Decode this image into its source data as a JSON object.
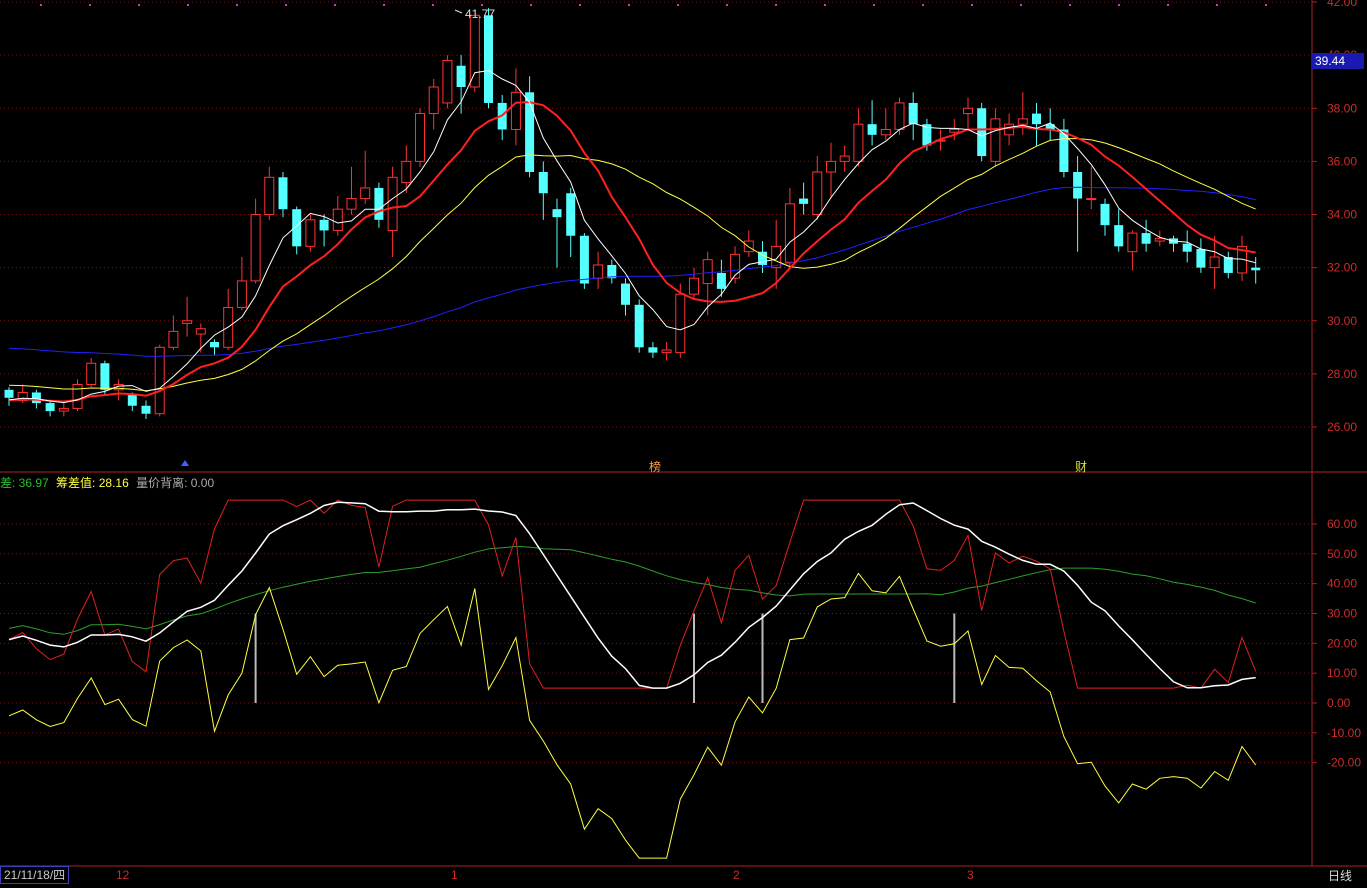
{
  "main_axis": {
    "ticks": [
      "42.00",
      "40.00",
      "38.00",
      "36.00",
      "34.00",
      "32.00",
      "30.00",
      "28.00",
      "26.00"
    ],
    "tick_values": [
      42,
      40,
      38,
      36,
      34,
      32,
      30,
      28,
      26
    ],
    "last_price_tag": "39.44",
    "high_label": "41.77"
  },
  "sub_axis": {
    "ticks": [
      "60.00",
      "50.00",
      "40.00",
      "30.00",
      "20.00",
      "10.00",
      "0.00",
      "-10.00",
      "-20.00"
    ],
    "tick_values": [
      60,
      50,
      40,
      30,
      20,
      10,
      0,
      -10,
      -20
    ]
  },
  "legend": {
    "item1": "差: 36.97",
    "item2_label": "筹差值: 28.16",
    "item3_label": "量价背离: 0.00"
  },
  "markers": {
    "m1": "榜",
    "m2": "财"
  },
  "bottom": {
    "date": "21/11/18/四",
    "months": [
      "12",
      "1",
      "2",
      "3"
    ],
    "period": "日线"
  },
  "colors": {
    "up": "#ff3232",
    "down": "#54ffff",
    "ma5": "#ffffff",
    "ma10": "#ff2020",
    "ma20": "#ffff40",
    "ma60": "#2020ff",
    "grid": "#7a1010"
  },
  "chart_data": {
    "type": "candlestick",
    "candles": [
      [
        27.4,
        27.1,
        26.8,
        27.5
      ],
      [
        27.0,
        27.3,
        26.9,
        27.6
      ],
      [
        27.3,
        26.9,
        26.7,
        27.4
      ],
      [
        26.9,
        26.6,
        26.4,
        27.0
      ],
      [
        26.6,
        26.7,
        26.4,
        27.0
      ],
      [
        26.7,
        27.6,
        26.6,
        27.8
      ],
      [
        27.6,
        28.4,
        27.5,
        28.6
      ],
      [
        28.4,
        27.4,
        27.2,
        28.5
      ],
      [
        27.4,
        27.6,
        27.0,
        27.8
      ],
      [
        27.2,
        26.8,
        26.6,
        27.3
      ],
      [
        26.8,
        26.5,
        26.3,
        27.0
      ],
      [
        26.5,
        29.0,
        26.4,
        29.1
      ],
      [
        29.0,
        29.6,
        28.9,
        30.2
      ],
      [
        29.9,
        30.0,
        29.4,
        30.9
      ],
      [
        29.5,
        29.7,
        28.8,
        29.9
      ],
      [
        29.2,
        29.0,
        28.7,
        29.3
      ],
      [
        29.0,
        30.5,
        28.9,
        31.2
      ],
      [
        30.5,
        31.5,
        30.4,
        32.4
      ],
      [
        31.5,
        34.0,
        31.4,
        34.6
      ],
      [
        34.0,
        35.4,
        33.8,
        35.8
      ],
      [
        35.4,
        34.2,
        33.9,
        35.6
      ],
      [
        34.2,
        32.8,
        32.5,
        34.3
      ],
      [
        32.8,
        33.8,
        32.6,
        34.0
      ],
      [
        33.8,
        33.4,
        32.8,
        34.0
      ],
      [
        33.4,
        34.2,
        33.2,
        34.7
      ],
      [
        34.2,
        34.6,
        34.0,
        35.8
      ],
      [
        34.6,
        35.0,
        34.4,
        36.4
      ],
      [
        35.0,
        33.8,
        33.5,
        35.2
      ],
      [
        33.4,
        35.4,
        32.4,
        35.8
      ],
      [
        35.2,
        36.0,
        34.8,
        36.6
      ],
      [
        36.0,
        37.8,
        35.8,
        38.0
      ],
      [
        37.8,
        38.8,
        37.2,
        39.1
      ],
      [
        38.2,
        39.8,
        38.0,
        40.0
      ],
      [
        39.6,
        38.8,
        37.8,
        40.0
      ],
      [
        38.8,
        41.5,
        38.6,
        41.5
      ],
      [
        41.5,
        38.2,
        38.0,
        41.77
      ],
      [
        38.2,
        37.2,
        36.8,
        38.5
      ],
      [
        37.2,
        38.6,
        36.6,
        39.5
      ],
      [
        38.6,
        35.6,
        35.4,
        39.2
      ],
      [
        35.6,
        34.8,
        33.8,
        36.0
      ],
      [
        34.2,
        33.9,
        32.0,
        34.6
      ],
      [
        34.8,
        33.2,
        32.4,
        35.0
      ],
      [
        33.2,
        31.4,
        31.2,
        33.3
      ],
      [
        31.6,
        32.1,
        31.2,
        32.6
      ],
      [
        32.1,
        31.6,
        31.4,
        32.3
      ],
      [
        31.4,
        30.6,
        30.2,
        31.6
      ],
      [
        30.6,
        29.0,
        28.8,
        30.8
      ],
      [
        29.0,
        28.8,
        28.6,
        29.2
      ],
      [
        28.8,
        28.9,
        28.5,
        29.2
      ],
      [
        28.8,
        31.0,
        28.6,
        31.4
      ],
      [
        31.0,
        31.6,
        30.8,
        32.0
      ],
      [
        31.4,
        32.3,
        30.2,
        32.6
      ],
      [
        31.8,
        31.2,
        30.9,
        32.3
      ],
      [
        31.6,
        32.5,
        31.4,
        32.8
      ],
      [
        32.6,
        33.0,
        32.4,
        33.4
      ],
      [
        32.6,
        32.1,
        31.8,
        33.0
      ],
      [
        32.0,
        32.8,
        31.2,
        33.8
      ],
      [
        32.2,
        34.4,
        32.0,
        35.0
      ],
      [
        34.6,
        34.4,
        34.0,
        35.2
      ],
      [
        34.0,
        35.6,
        33.8,
        36.2
      ],
      [
        35.6,
        36.0,
        34.6,
        36.7
      ],
      [
        36.0,
        36.2,
        35.6,
        36.6
      ],
      [
        36.0,
        37.4,
        35.8,
        38.0
      ],
      [
        37.4,
        37.0,
        36.6,
        38.3
      ],
      [
        37.0,
        37.2,
        36.8,
        38.0
      ],
      [
        37.2,
        38.2,
        37.0,
        38.4
      ],
      [
        38.2,
        37.4,
        36.8,
        38.6
      ],
      [
        37.4,
        36.6,
        36.4,
        37.6
      ],
      [
        36.8,
        36.8,
        36.4,
        37.2
      ],
      [
        37.1,
        37.2,
        36.8,
        37.6
      ],
      [
        37.8,
        38.0,
        37.2,
        38.4
      ],
      [
        38.0,
        36.2,
        36.0,
        38.2
      ],
      [
        36.0,
        37.6,
        35.8,
        38.0
      ],
      [
        37.0,
        37.4,
        36.6,
        37.8
      ],
      [
        37.4,
        37.6,
        37.0,
        38.6
      ],
      [
        37.8,
        37.4,
        36.6,
        38.2
      ],
      [
        37.4,
        37.2,
        36.8,
        38.0
      ],
      [
        37.2,
        35.6,
        35.4,
        37.6
      ],
      [
        35.6,
        34.6,
        32.6,
        36.2
      ],
      [
        34.6,
        34.6,
        34.2,
        35.8
      ],
      [
        34.4,
        33.6,
        33.2,
        34.6
      ],
      [
        33.6,
        32.8,
        32.6,
        34.2
      ],
      [
        32.6,
        33.3,
        31.9,
        33.4
      ],
      [
        33.3,
        32.9,
        32.6,
        33.8
      ],
      [
        33.0,
        33.1,
        32.8,
        33.4
      ],
      [
        33.1,
        32.9,
        32.6,
        33.2
      ],
      [
        32.9,
        32.6,
        32.2,
        33.4
      ],
      [
        32.7,
        32.0,
        31.8,
        33.1
      ],
      [
        32.0,
        32.4,
        31.2,
        33.2
      ],
      [
        32.4,
        31.8,
        31.6,
        32.6
      ],
      [
        31.8,
        32.8,
        31.5,
        33.2
      ],
      [
        32.0,
        31.9,
        31.4,
        32.4
      ]
    ]
  }
}
